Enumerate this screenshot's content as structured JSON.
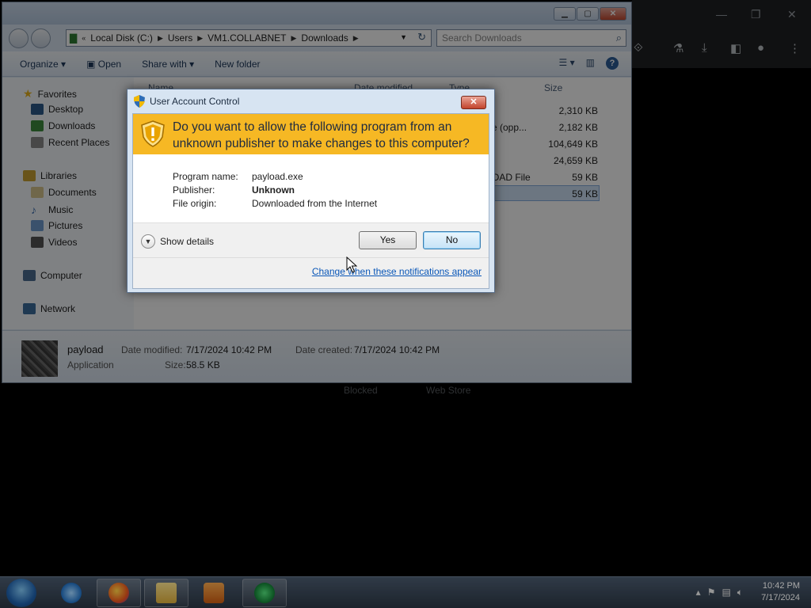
{
  "explorer": {
    "address": [
      "Local Disk (C:)",
      "Users",
      "VM1.COLLABNET",
      "Downloads"
    ],
    "address_prefix": "«",
    "search_placeholder": "Search Downloads",
    "toolbar": {
      "organize": "Organize ▾",
      "open": "Open",
      "share_with": "Share with ▾",
      "new_folder": "New folder"
    },
    "nav": {
      "favorites": "Favorites",
      "desktop": "Desktop",
      "downloads": "Downloads",
      "recent_places": "Recent Places",
      "libraries": "Libraries",
      "documents": "Documents",
      "music": "Music",
      "pictures": "Pictures",
      "videos": "Videos",
      "computer": "Computer",
      "network": "Network"
    },
    "columns": {
      "name": "Name",
      "date_modified": "Date modified",
      "type": "Type",
      "size": "Size"
    },
    "rows": [
      {
        "type": "",
        "size": "2,310 KB"
      },
      {
        "type": "e (opp...",
        "size": "2,182 KB"
      },
      {
        "type": "",
        "size": "104,649 KB"
      },
      {
        "type": "",
        "size": "24,659 KB"
      },
      {
        "type": "OAD File",
        "size": "59 KB"
      },
      {
        "type": "",
        "size": "59 KB"
      }
    ],
    "details": {
      "name": "payload",
      "kind": "Application",
      "date_modified_label": "Date modified:",
      "date_modified": "7/17/2024 10:42 PM",
      "date_created_label": "Date created:",
      "date_created": "7/17/2024 10:42 PM",
      "size_label": "Size:",
      "size": "58.5 KB"
    }
  },
  "browser": {
    "blocked": "Blocked",
    "web_store": "Web Store"
  },
  "uac": {
    "title": "User Account Control",
    "question": "Do you want to allow the following program from an unknown publisher to make changes to this computer?",
    "program_label": "Program name:",
    "program_value": "payload.exe",
    "publisher_label": "Publisher:",
    "publisher_value": "Unknown",
    "origin_label": "File origin:",
    "origin_value": "Downloaded from the Internet",
    "show_details": "Show details",
    "yes": "Yes",
    "no": "No",
    "change_link": "Change when these notifications appear"
  },
  "taskbar": {
    "time": "10:42 PM",
    "date": "7/17/2024"
  },
  "colors": {
    "banner": "#f6b824",
    "link": "#0a57b8"
  }
}
